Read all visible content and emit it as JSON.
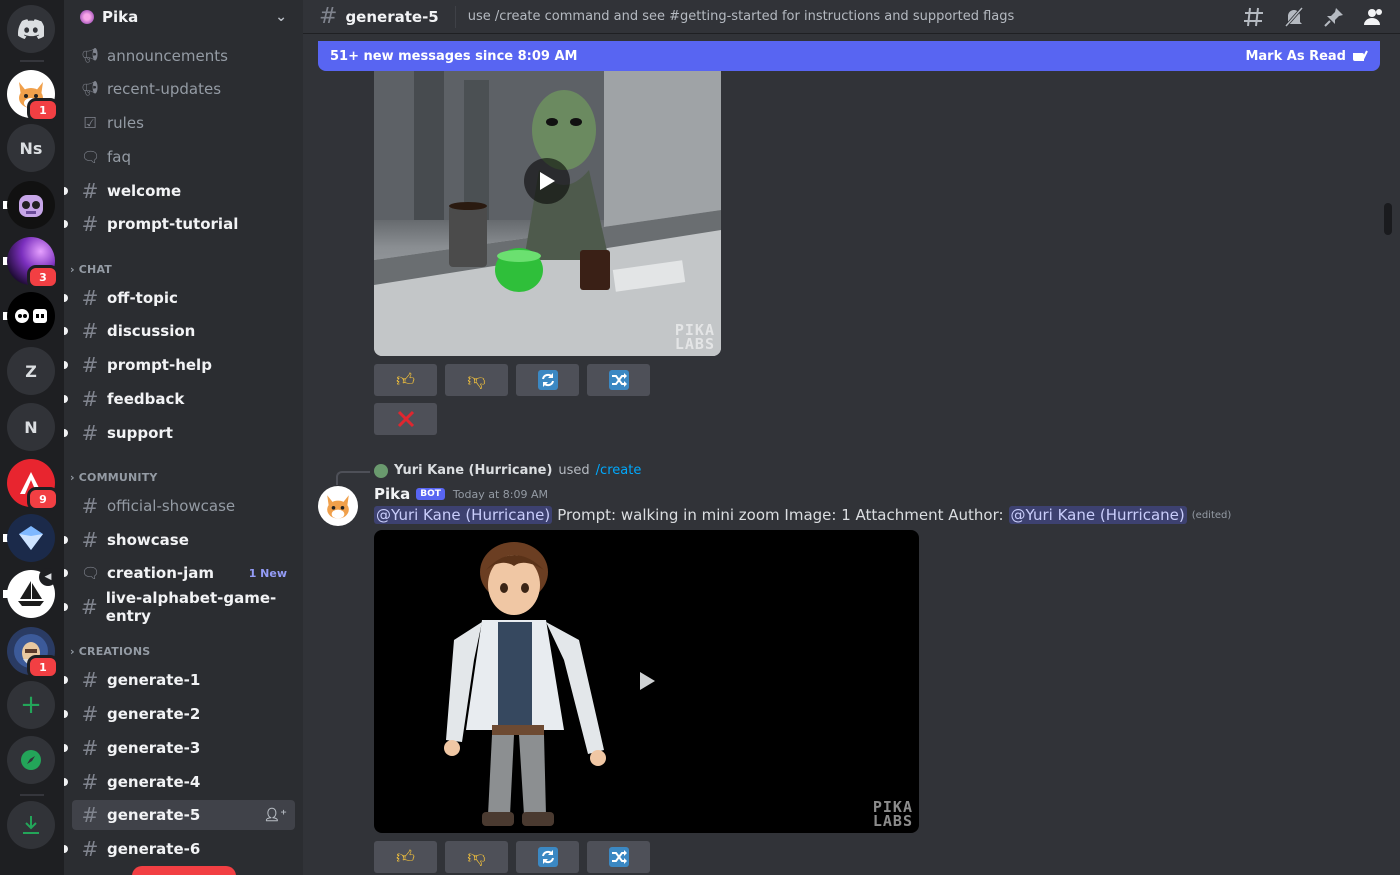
{
  "servers": [
    {
      "kind": "home",
      "label": ""
    },
    {
      "kind": "image",
      "label": "",
      "badge": "1"
    },
    {
      "kind": "text",
      "label": "Ns"
    },
    {
      "kind": "image",
      "label": ""
    },
    {
      "kind": "image",
      "label": "",
      "badge": "3"
    },
    {
      "kind": "image",
      "label": ""
    },
    {
      "kind": "text",
      "label": "Z"
    },
    {
      "kind": "text",
      "label": "N"
    },
    {
      "kind": "image",
      "label": "",
      "badge": "9"
    },
    {
      "kind": "image",
      "label": ""
    },
    {
      "kind": "image",
      "label": ""
    },
    {
      "kind": "image",
      "label": "",
      "badge": "1"
    }
  ],
  "guild": {
    "name": "Pika"
  },
  "channels": {
    "announcements": "announcements",
    "recent_updates": "recent-updates",
    "rules": "rules",
    "faq": "faq",
    "welcome": "welcome",
    "prompt_tutorial": "prompt-tutorial",
    "chat_category": "CHAT",
    "off_topic": "off-topic",
    "discussion": "discussion",
    "prompt_help": "prompt-help",
    "feedback": "feedback",
    "support": "support",
    "community_category": "COMMUNITY",
    "official_showcase": "official-showcase",
    "showcase": "showcase",
    "creation_jam": "creation-jam",
    "creation_jam_new": "1 New",
    "live_alphabet": "live-alphabet-game-entry",
    "creations_category": "CREATIONS",
    "generate_1": "generate-1",
    "generate_2": "generate-2",
    "generate_3": "generate-3",
    "generate_4": "generate-4",
    "generate_5": "generate-5",
    "generate_6": "generate-6"
  },
  "topbar": {
    "channel": "generate-5",
    "topic": "use /create command and see #getting-started for instructions and supported flags"
  },
  "newbar": {
    "text": "51+ new messages since 8:09 AM",
    "mark": "Mark As Read"
  },
  "message": {
    "reply_user": "Yuri Kane (Hurricane)",
    "reply_used": "used",
    "reply_cmd": "/create",
    "author": "Pika",
    "bot_tag": "BOT",
    "timestamp": "Today at 8:09 AM",
    "mention1": "@Yuri Kane (Hurricane)",
    "body": "Prompt: walking  in mini zoom  Image: 1 Attachment  Author:",
    "mention2": "@Yuri Kane (Hurricane)",
    "edited": "(edited)"
  },
  "watermark": {
    "line1": "PIKA",
    "line2": "LABS"
  }
}
